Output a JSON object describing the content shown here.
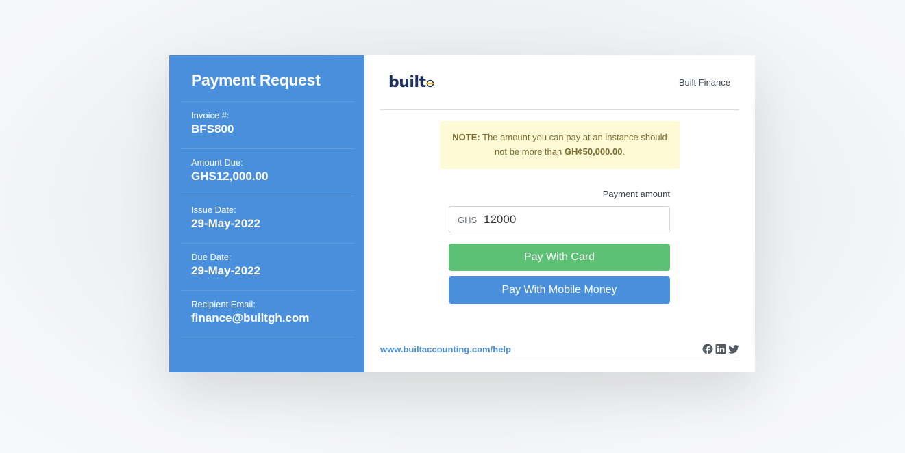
{
  "sidebar": {
    "title": "Payment Request",
    "items": [
      {
        "label": "Invoice #:",
        "value": "BFS800"
      },
      {
        "label": "Amount Due:",
        "value": "GHS12,000.00"
      },
      {
        "label": "Issue Date:",
        "value": "29-May-2022"
      },
      {
        "label": "Due Date:",
        "value": "29-May-2022"
      },
      {
        "label": "Recipient Email:",
        "value": "finance@builtgh.com"
      }
    ]
  },
  "header": {
    "logo_text": "built",
    "company_name": "Built Finance"
  },
  "note": {
    "prefix": "NOTE:",
    "text": "The amount you can pay at an instance should not be more than",
    "limit": "GH¢50,000.00",
    "suffix": "."
  },
  "payment": {
    "label": "Payment amount",
    "currency": "GHS",
    "value": "12000",
    "card_button": "Pay With Card",
    "momo_button": "Pay With Mobile Money"
  },
  "footer": {
    "help_link": "www.builtaccounting.com/help",
    "social_icons": [
      "facebook-icon",
      "linkedin-icon",
      "twitter-icon"
    ]
  },
  "colors": {
    "sidebar": "#4a8fdb",
    "card_button": "#5cc174",
    "momo_button": "#4a8fdb",
    "note_bg": "#fffad6"
  }
}
